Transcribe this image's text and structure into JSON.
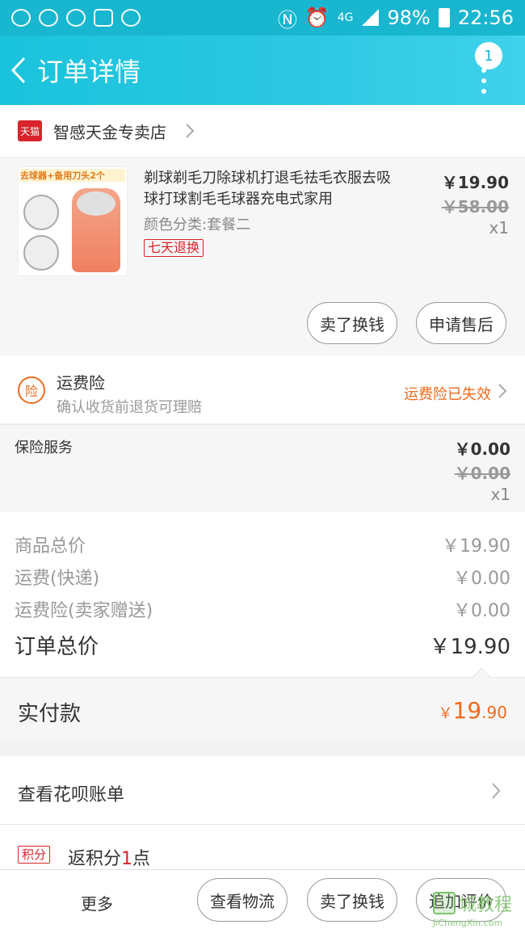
{
  "status_bar": {
    "battery": "98%",
    "network": "4G",
    "time": "22:56"
  },
  "header": {
    "title": "订单详情",
    "badge_count": "1"
  },
  "store": {
    "platform_badge": "天猫",
    "name": "智感天金专卖店"
  },
  "product": {
    "image_banner": "去球器+备用刀头2个",
    "title": "剃球剃毛刀除球机打退毛祛毛衣服去吸球打球割毛毛球器充电式家用",
    "spec": "颜色分类:套餐二",
    "return_tag": "七天退换",
    "price": "￥19.90",
    "original_price": "￥58.00",
    "quantity": "x1",
    "buttons": {
      "sell": "卖了换钱",
      "after_sale": "申请售后"
    }
  },
  "shipping_insurance": {
    "icon_text": "险",
    "title": "运费险",
    "description": "确认收货前退货可理赔",
    "status": "运费险已失效"
  },
  "insurance_service": {
    "label": "保险服务",
    "price": "￥0.00",
    "original_price": "￥0.00",
    "quantity": "x1"
  },
  "summary": {
    "rows": [
      {
        "label": "商品总价",
        "value": "￥19.90"
      },
      {
        "label": "运费(快递)",
        "value": "￥0.00"
      },
      {
        "label": "运费险(卖家赠送)",
        "value": "￥0.00"
      }
    ],
    "total_label": "订单总价",
    "total_value": "￥19.90"
  },
  "paid": {
    "label": "实付款",
    "currency": "￥",
    "integer": "19",
    "decimal": ".90"
  },
  "huabei": {
    "label": "查看花呗账单"
  },
  "points": {
    "tag": "积分",
    "prefix": "返积分",
    "number": "1",
    "suffix": "点"
  },
  "bottom_bar": {
    "more": "更多",
    "logistics": "查看物流",
    "sell": "卖了换钱",
    "review": "追加评价"
  },
  "watermark": {
    "text": "城教程",
    "site": "JiChengXin.com"
  },
  "colors": {
    "header": "#19b6cf",
    "accent_orange": "#f06a1e",
    "tmall_red": "#d9232a"
  }
}
